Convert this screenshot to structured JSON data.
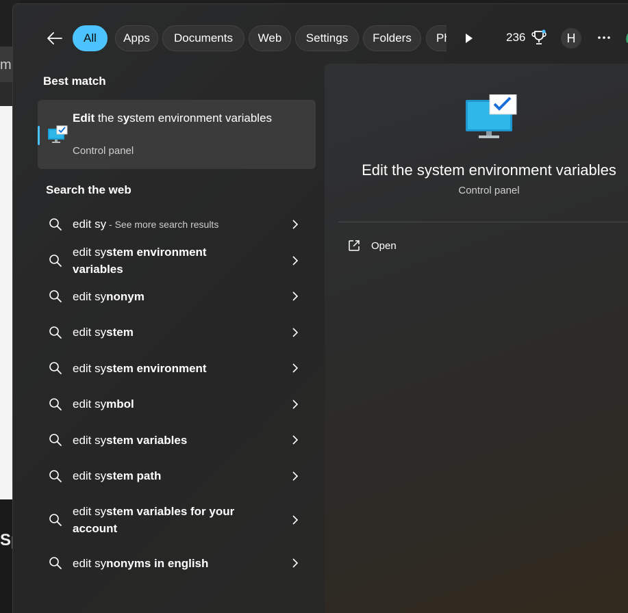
{
  "filters": {
    "items": [
      {
        "label": "All",
        "active": true
      },
      {
        "label": "Apps",
        "active": false
      },
      {
        "label": "Documents",
        "active": false
      },
      {
        "label": "Web",
        "active": false
      },
      {
        "label": "Settings",
        "active": false
      },
      {
        "label": "Folders",
        "active": false
      },
      {
        "label": "Ph",
        "active": false
      }
    ]
  },
  "rewards": {
    "points": "236"
  },
  "profile": {
    "initial": "H"
  },
  "best_match": {
    "heading": "Best match",
    "title_bold": "Edit",
    "title_mid": " the s",
    "title_bold2": "y",
    "title_rest": "stem environment variables",
    "subtitle": "Control panel"
  },
  "web_search": {
    "heading": "Search the web",
    "items": [
      {
        "query": "edit sy",
        "rest": "",
        "hint": " - See more search results"
      },
      {
        "query": "edit sy",
        "rest": "stem environment variables",
        "hint": ""
      },
      {
        "query": "edit sy",
        "rest": "nonym",
        "hint": ""
      },
      {
        "query": "edit sy",
        "rest": "stem",
        "hint": ""
      },
      {
        "query": "edit sy",
        "rest": "stem environment",
        "hint": ""
      },
      {
        "query": "edit sy",
        "rest": "mbol",
        "hint": ""
      },
      {
        "query": "edit sy",
        "rest": "stem variables",
        "hint": ""
      },
      {
        "query": "edit sy",
        "rest": "stem path",
        "hint": ""
      },
      {
        "query": "edit sy",
        "rest": "stem variables for your account",
        "hint": ""
      },
      {
        "query": "edit sy",
        "rest": "nonyms in english",
        "hint": ""
      }
    ]
  },
  "detail": {
    "title": "Edit the system environment variables",
    "subtitle": "Control panel",
    "actions": [
      {
        "label": "Open",
        "icon": "open-external-icon"
      }
    ]
  },
  "colors": {
    "accent": "#4cc2ff",
    "panel": "#262626",
    "hover": "#3b3b3b"
  }
}
